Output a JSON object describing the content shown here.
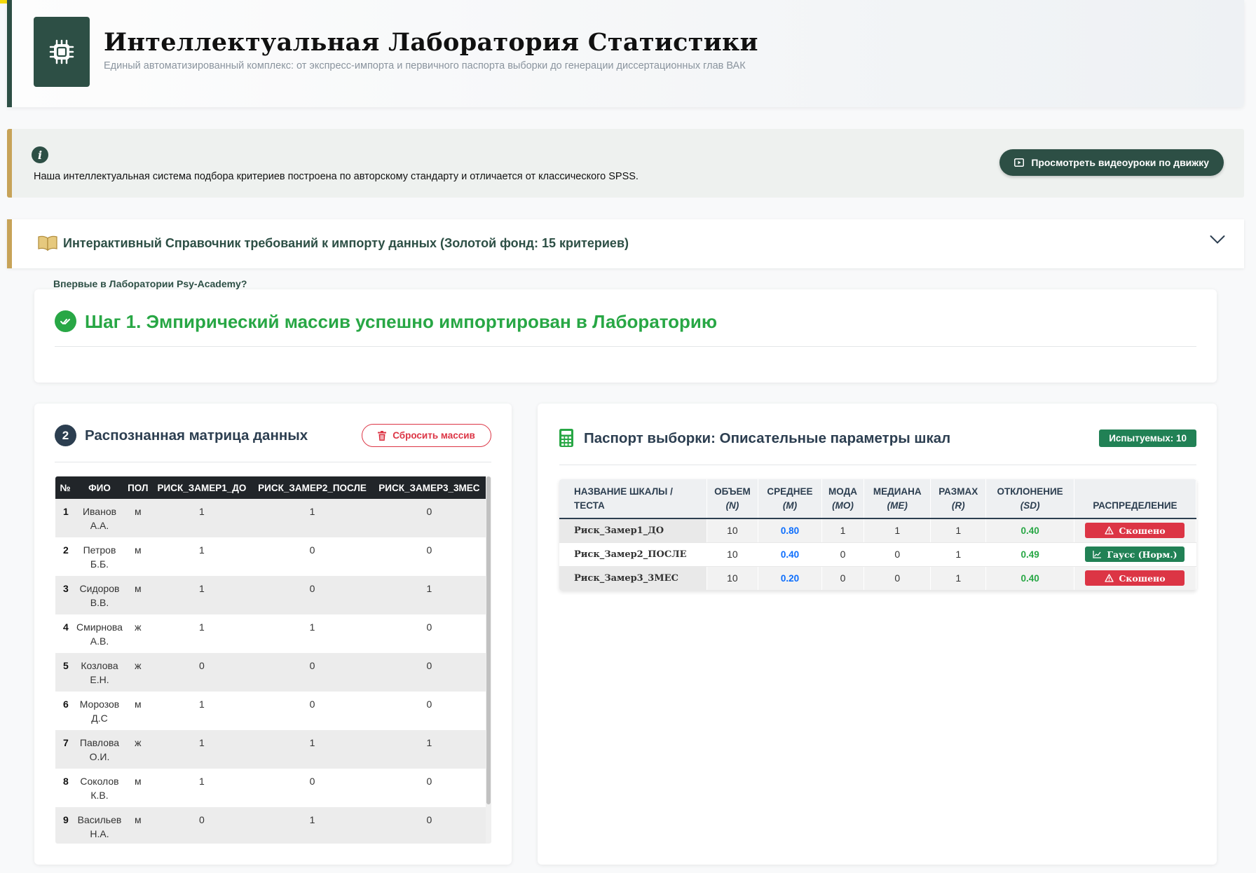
{
  "header": {
    "title": "Интеллектуальная Лаборатория Статистики",
    "subtitle": "Единый автоматизированный комплекс: от экспресс-импорта и первичного паспорта выборки до генерации диссертационных глав ВАК",
    "logo_icon": "cpu-chip-icon"
  },
  "notice": {
    "title": "Впервые в Лаборатории Psy-Academy?",
    "text": "Наша интеллектуальная система подбора критериев построена по авторскому стандарту и отличается от классического SPSS.",
    "video_button": "Просмотреть видеоуроки по движку"
  },
  "accordion": {
    "title": "Интерактивный Справочник требований к импорту данных (Золотой фонд: 15 критериев)"
  },
  "step1": {
    "title": "Шаг 1. Эмпирический массив успешно импортирован в Лабораторию"
  },
  "matrix": {
    "step_number": "2",
    "title": "Распознанная матрица данных",
    "reset_button": "Сбросить массив",
    "columns": [
      "№",
      "ФИО",
      "ПОЛ",
      "РИСК_ЗАМЕР1_ДО",
      "РИСК_ЗАМЕР2_ПОСЛЕ",
      "РИСК_ЗАМЕР3_3МЕС"
    ],
    "rows": [
      [
        "1",
        "Иванов А.А.",
        "м",
        "1",
        "1",
        "0"
      ],
      [
        "2",
        "Петров Б.Б.",
        "м",
        "1",
        "0",
        "0"
      ],
      [
        "3",
        "Сидоров В.В.",
        "м",
        "1",
        "0",
        "1"
      ],
      [
        "4",
        "Смирнова А.В.",
        "ж",
        "1",
        "1",
        "0"
      ],
      [
        "5",
        "Козлова Е.Н.",
        "ж",
        "0",
        "0",
        "0"
      ],
      [
        "6",
        "Морозов Д.С",
        "м",
        "1",
        "0",
        "0"
      ],
      [
        "7",
        "Павлова О.И.",
        "ж",
        "1",
        "1",
        "1"
      ],
      [
        "8",
        "Соколов К.В.",
        "м",
        "1",
        "0",
        "0"
      ],
      [
        "9",
        "Васильев Н.А.",
        "м",
        "0",
        "1",
        "0"
      ]
    ]
  },
  "passport": {
    "title": "Паспорт выборки: Описательные параметры шкал",
    "subjects_badge": "Испытуемых: 10",
    "columns": [
      {
        "main": "НАЗВАНИЕ ШКАЛЫ /",
        "sub": "ТЕСТА"
      },
      {
        "main": "ОБЪЕМ",
        "sub": "(N)"
      },
      {
        "main": "СРЕДНЕЕ",
        "sub": "(M)"
      },
      {
        "main": "МОДА",
        "sub": "(MO)"
      },
      {
        "main": "МЕДИАНА",
        "sub": "(ME)"
      },
      {
        "main": "РАЗМАХ",
        "sub": "(R)"
      },
      {
        "main": "ОТКЛОНЕНИЕ",
        "sub": "(SD)"
      },
      {
        "main": "РАСПРЕДЕЛЕНИЕ",
        "sub": ""
      }
    ],
    "rows": [
      {
        "name": "Риск_Замер1_ДО",
        "n": "10",
        "mean": "0.80",
        "mode": "1",
        "median": "1",
        "range": "1",
        "sd": "0.40",
        "dist": "Скошено",
        "dist_type": "bad"
      },
      {
        "name": "Риск_Замер2_ПОСЛЕ",
        "n": "10",
        "mean": "0.40",
        "mode": "0",
        "median": "0",
        "range": "1",
        "sd": "0.49",
        "dist": "Гаусс (Норм.)",
        "dist_type": "good"
      },
      {
        "name": "Риск_Замер3_3МЕС",
        "n": "10",
        "mean": "0.20",
        "mode": "0",
        "median": "0",
        "range": "1",
        "sd": "0.40",
        "dist": "Скошено",
        "dist_type": "bad"
      }
    ]
  },
  "colors": {
    "brand": "#2d4f45",
    "gold": "#c7a358",
    "success": "#28a745",
    "danger": "#dc3545",
    "mean_blue": "#0d6efd"
  }
}
